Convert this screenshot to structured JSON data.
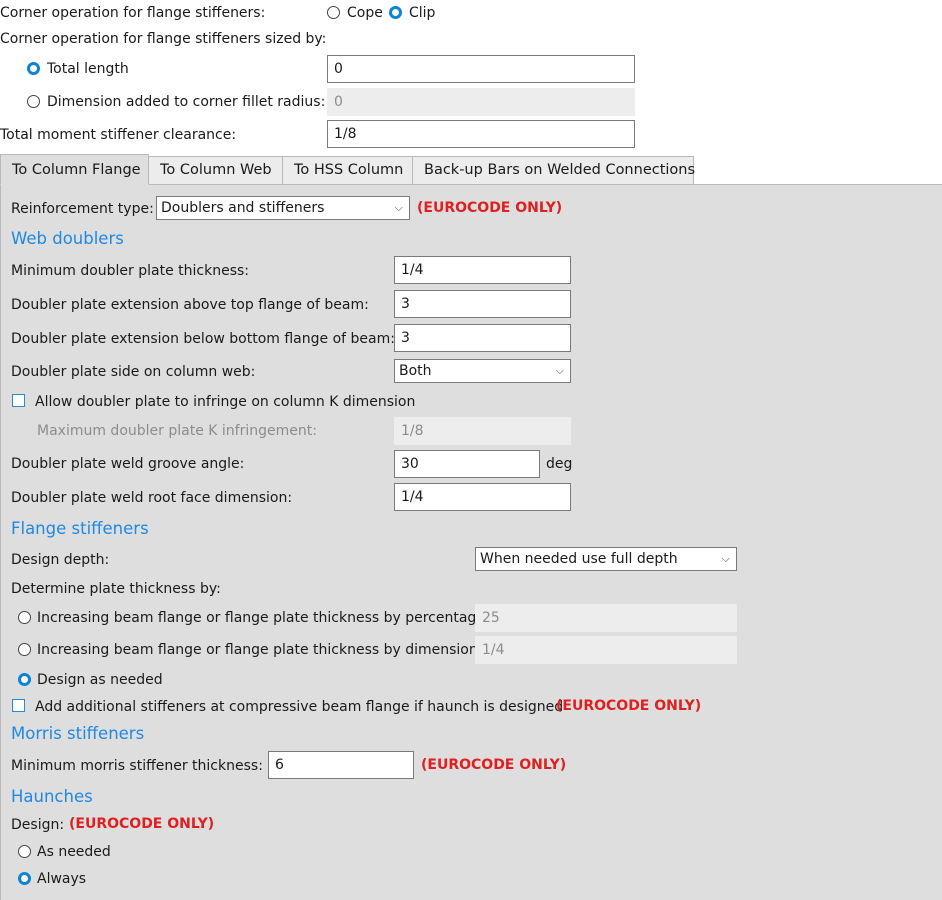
{
  "top": {
    "corner_operation_label": "Corner operation for flange stiffeners:",
    "corner_cope_label": "Cope",
    "corner_clip_label": "Clip",
    "corner_selected": "Clip",
    "sized_by_label": "Corner operation for flange stiffeners sized by:",
    "total_length_label": "Total length",
    "total_length_value": "0",
    "dimension_added_label": "Dimension added to corner fillet radius:",
    "dimension_added_value": "0",
    "sized_by_selected": "Total length",
    "clearance_label": "Total moment stiffener clearance:",
    "clearance_value": "1/8"
  },
  "tabs": [
    {
      "label": "To Column Flange",
      "active": true
    },
    {
      "label": "To Column Web",
      "active": false
    },
    {
      "label": "To HSS Column",
      "active": false
    },
    {
      "label": "Back-up Bars on Welded Connections",
      "active": false
    }
  ],
  "reinforcement": {
    "label": "Reinforcement type:",
    "value": "Doublers and stiffeners",
    "note": "(EUROCODE ONLY)"
  },
  "web_doublers": {
    "heading": "Web doublers",
    "min_thickness_label": "Minimum doubler plate thickness:",
    "min_thickness_value": "1/4",
    "ext_above_label": "Doubler plate extension above top flange of beam:",
    "ext_above_value": "3",
    "ext_below_label": "Doubler plate extension below bottom flange of beam:",
    "ext_below_value": "3",
    "side_label": "Doubler plate side on column web:",
    "side_value": "Both",
    "allow_infringe_label": "Allow doubler plate to infringe on column K dimension",
    "allow_infringe_checked": false,
    "max_k_label": "Maximum doubler plate K infringement:",
    "max_k_value": "1/8",
    "groove_label": "Doubler plate weld groove angle:",
    "groove_value": "30",
    "groove_unit": "deg",
    "root_face_label": "Doubler plate weld root face dimension:",
    "root_face_value": "1/4"
  },
  "flange_stiffeners": {
    "heading": "Flange stiffeners",
    "design_depth_label": "Design depth:",
    "design_depth_value": "When needed use full depth",
    "determine_label": "Determine plate thickness by:",
    "by_percentage_label": "Increasing beam flange or flange plate thickness by percentage",
    "by_percentage_value": "25",
    "by_dimension_label": "Increasing beam flange or flange plate thickness by dimension",
    "by_dimension_value": "1/4",
    "design_as_needed_label": "Design as needed",
    "selected": "Design as needed",
    "haunch_label": "Add additional stiffeners at compressive beam flange if haunch is designed",
    "haunch_checked": false,
    "haunch_note": "(EUROCODE ONLY)"
  },
  "morris_stiffeners": {
    "heading": "Morris stiffeners",
    "min_thickness_label": "Minimum morris stiffener thickness:",
    "min_thickness_value": "6",
    "note": "(EUROCODE ONLY)"
  },
  "haunches": {
    "heading": "Haunches",
    "design_label": "Design:",
    "design_note": "(EUROCODE ONLY)",
    "as_needed_label": "As needed",
    "always_label": "Always",
    "selected": "Always"
  },
  "icons": {
    "dropdown": "chevron-down-icon",
    "radio": "radio-button-icon",
    "checkbox": "checkbox-icon"
  },
  "colors": {
    "accent": "#0a84d6",
    "section_heading": "#1e88e5",
    "eurocode_note": "#e02020",
    "panel_background": "#dedede"
  }
}
